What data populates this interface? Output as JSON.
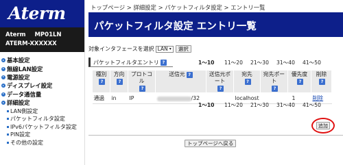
{
  "sidebar": {
    "logo": "Aterm",
    "model_line1_a": "Aterm",
    "model_line1_b": "MP01LN",
    "model_line2": "ATERM-XXXXXX",
    "items": [
      {
        "label": "基本設定"
      },
      {
        "label": "無線LAN設定"
      },
      {
        "label": "電源設定"
      },
      {
        "label": "ディスプレイ設定"
      },
      {
        "label": "データ通信量"
      },
      {
        "label": "詳細設定"
      }
    ],
    "subitems": [
      {
        "label": "LAN側設定"
      },
      {
        "label": "パケットフィルタ設定"
      },
      {
        "label": "IPv6パケットフィルタ設定"
      },
      {
        "label": "PIN設定"
      },
      {
        "label": "その他の設定"
      }
    ]
  },
  "breadcrumb": "トップページ > 詳細設定 > パケットフィルタ設定 > エントリ一覧",
  "title": "パケットフィルタ設定 エントリ一覧",
  "interface": {
    "label": "対象インタフェースを選択",
    "selected": "LAN",
    "select_button": "選択"
  },
  "section_title": "パケットフィルタエントリ",
  "pager": [
    "1〜10",
    "11〜20",
    "21〜30",
    "31〜40",
    "41〜50"
  ],
  "table": {
    "headers": [
      "種別",
      "方向",
      "プロトコル",
      "送信元",
      "送信元ポート",
      "宛先",
      "宛先ポート",
      "優先度",
      "削除"
    ],
    "row": {
      "type": "通過",
      "direction": "in",
      "protocol": "IP",
      "source_suffix": "/32",
      "source_port": "",
      "destination": "localhost",
      "destination_port": "",
      "priority": "1",
      "delete": "削除"
    }
  },
  "add_button": "追加",
  "back_button": "トップページへ戻る",
  "colors": {
    "header_blue": "#0d1f8a",
    "highlight_circle": "#e01010"
  }
}
